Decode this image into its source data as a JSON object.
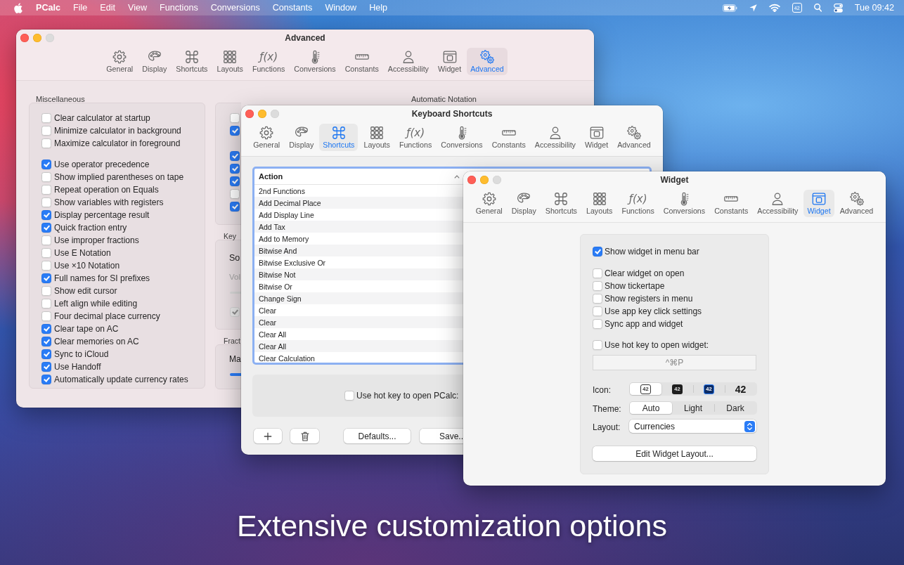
{
  "menu_bar": {
    "app_name": "PCalc",
    "menus": [
      "File",
      "Edit",
      "View",
      "Functions",
      "Conversions",
      "Constants",
      "Window",
      "Help"
    ],
    "status_item": "42",
    "clock": "Tue 09:42"
  },
  "advanced_window": {
    "title": "Advanced",
    "toolbar": [
      {
        "label": "General",
        "selected": false
      },
      {
        "label": "Display",
        "selected": false
      },
      {
        "label": "Shortcuts",
        "selected": false
      },
      {
        "label": "Layouts",
        "selected": false
      },
      {
        "label": "Functions",
        "glyph": "ƒ(x)",
        "selected": false
      },
      {
        "label": "Conversions",
        "selected": false
      },
      {
        "label": "Constants",
        "selected": false
      },
      {
        "label": "Accessibility",
        "selected": false
      },
      {
        "label": "Widget",
        "selected": false
      },
      {
        "label": "Advanced",
        "selected": true
      }
    ],
    "miscellaneous": {
      "heading": "Miscellaneous",
      "groups": [
        [
          {
            "label": "Clear calculator at startup",
            "checked": false
          },
          {
            "label": "Minimize calculator in background",
            "checked": false
          },
          {
            "label": "Maximize calculator in foreground",
            "checked": false
          }
        ],
        [
          {
            "label": "Use operator precedence",
            "checked": true
          },
          {
            "label": "Show implied parentheses on tape",
            "checked": false
          },
          {
            "label": "Repeat operation on Equals",
            "checked": false
          },
          {
            "label": "Show variables with registers",
            "checked": false
          },
          {
            "label": "Display percentage result",
            "checked": true
          },
          {
            "label": "Quick fraction entry",
            "checked": true
          },
          {
            "label": "Use improper fractions",
            "checked": false
          },
          {
            "label": "Use E Notation",
            "checked": false
          },
          {
            "label": "Use ×10 Notation",
            "checked": false
          },
          {
            "label": "Full names for SI prefixes",
            "checked": true
          },
          {
            "label": "Show edit cursor",
            "checked": false
          },
          {
            "label": "Left align while editing",
            "checked": false
          },
          {
            "label": "Four decimal place currency",
            "checked": false
          },
          {
            "label": "Clear tape on AC",
            "checked": true
          },
          {
            "label": "Clear memories on AC",
            "checked": true
          },
          {
            "label": "Sync to iCloud",
            "checked": true
          },
          {
            "label": "Use Handoff",
            "checked": true
          },
          {
            "label": "Automatically update currency rates",
            "checked": true
          }
        ]
      ]
    },
    "automatic_notation": {
      "heading": "Automatic Notation"
    },
    "column_2": {
      "checkbox_groups": [
        [
          {
            "checked": false
          },
          {
            "checked": true
          }
        ],
        [
          {
            "checked": true
          },
          {
            "checked": true
          },
          {
            "checked": true
          },
          {
            "checked": false
          },
          {
            "checked": true
          }
        ]
      ]
    },
    "key_section": {
      "heading": "Key",
      "label_1": "So",
      "label_2": "Vol",
      "checkbox": {
        "checked": true,
        "disabled": true
      }
    },
    "fraction_section": {
      "heading": "Fract",
      "label": "Ma"
    }
  },
  "shortcuts_window": {
    "title": "Keyboard Shortcuts",
    "toolbar": [
      {
        "label": "General",
        "selected": false
      },
      {
        "label": "Display",
        "selected": false
      },
      {
        "label": "Shortcuts",
        "selected": true
      },
      {
        "label": "Layouts",
        "selected": false
      },
      {
        "label": "Functions",
        "glyph": "ƒ(x)",
        "selected": false
      },
      {
        "label": "Conversions",
        "selected": false
      },
      {
        "label": "Constants",
        "selected": false
      },
      {
        "label": "Accessibility",
        "selected": false
      },
      {
        "label": "Widget",
        "selected": false
      },
      {
        "label": "Advanced",
        "selected": false
      }
    ],
    "table": {
      "columns": [
        "Action"
      ],
      "rows": [
        [
          "2nd Functions"
        ],
        [
          "Add Decimal Place"
        ],
        [
          "Add Display Line"
        ],
        [
          "Add Tax"
        ],
        [
          "Add to Memory"
        ],
        [
          "Bitwise And"
        ],
        [
          "Bitwise Exclusive Or"
        ],
        [
          "Bitwise Not"
        ],
        [
          "Bitwise Or"
        ],
        [
          "Change Sign"
        ],
        [
          "Clear"
        ],
        [
          "Clear"
        ],
        [
          "Clear All"
        ],
        [
          "Clear All"
        ],
        [
          "Clear Calculation"
        ]
      ]
    },
    "hot_key": {
      "label": "Use hot key to open PCalc:",
      "checked": false
    },
    "buttons": [
      {
        "kind": "add"
      },
      {
        "kind": "remove"
      },
      {
        "kind": "text",
        "label": "Defaults..."
      },
      {
        "kind": "text",
        "label": "Save.."
      }
    ]
  },
  "widget_window": {
    "title": "Widget",
    "toolbar": [
      {
        "label": "General",
        "selected": false
      },
      {
        "label": "Display",
        "selected": false
      },
      {
        "label": "Shortcuts",
        "selected": false
      },
      {
        "label": "Layouts",
        "selected": false
      },
      {
        "label": "Functions",
        "glyph": "ƒ(x)",
        "selected": false
      },
      {
        "label": "Conversions",
        "selected": false
      },
      {
        "label": "Constants",
        "selected": false
      },
      {
        "label": "Accessibility",
        "selected": false
      },
      {
        "label": "Widget",
        "selected": true
      },
      {
        "label": "Advanced",
        "selected": false
      }
    ],
    "checkbox_groups": [
      [
        {
          "label": "Show widget in menu bar",
          "checked": true
        }
      ],
      [
        {
          "label": "Clear widget on open",
          "checked": false
        },
        {
          "label": "Show tickertape",
          "checked": false
        },
        {
          "label": "Show registers in menu",
          "checked": false
        },
        {
          "label": "Use app key click settings",
          "checked": false
        },
        {
          "label": "Sync app and widget",
          "checked": false
        }
      ],
      [
        {
          "label": "Use hot key to open widget:",
          "checked": false
        }
      ]
    ],
    "hot_key_field": {
      "value": "^⌘P",
      "disabled": true
    },
    "icon_picker": {
      "label": "Icon:",
      "options": [
        {
          "kind": "outline",
          "label": "42",
          "selected": true
        },
        {
          "kind": "dark",
          "label": "42",
          "selected": false
        },
        {
          "kind": "blue",
          "label": "42",
          "selected": false
        },
        {
          "kind": "plain",
          "label": "42",
          "selected": false
        }
      ]
    },
    "theme_picker": {
      "label": "Theme:",
      "options": [
        {
          "label": "Auto",
          "selected": true
        },
        {
          "label": "Light",
          "selected": false
        },
        {
          "label": "Dark",
          "selected": false
        }
      ]
    },
    "layout_popup": {
      "label": "Layout:",
      "value": "Currencies"
    },
    "edit_button": "Edit Widget Layout..."
  },
  "caption": "Extensive customization options"
}
